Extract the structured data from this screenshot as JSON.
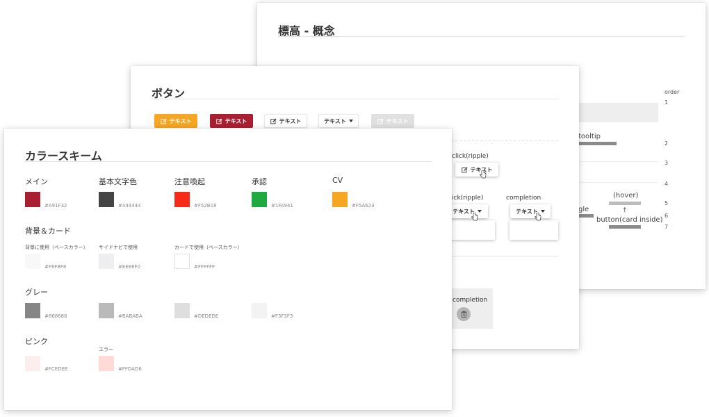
{
  "elevation_card": {
    "title": "標高 - 概念",
    "order_label": "order",
    "order_numbers": [
      "1",
      "2",
      "3",
      "4",
      "5",
      "6",
      "7"
    ],
    "labels": {
      "tooltip": "tooltip",
      "hover": "(hover)",
      "toggle_fragment": "gle",
      "card_inside": "button(card inside)",
      "arrow": "↑"
    }
  },
  "buttons_card": {
    "title": "ボタン",
    "buttons": [
      {
        "label": "テキスト",
        "style": "orange",
        "icon": "edit-icon"
      },
      {
        "label": "テキスト",
        "style": "red",
        "icon": "edit-icon"
      },
      {
        "label": "テキスト",
        "style": "outline",
        "icon": "edit-icon"
      },
      {
        "label": "テキスト",
        "style": "outline-dropdown",
        "icon": "chevron-down-icon"
      },
      {
        "label": "テキスト",
        "style": "disabled",
        "icon": "edit-icon"
      }
    ],
    "click_ripple_label": "click(ripple)",
    "click_ripple_button": "テキスト",
    "ick_ripple_label": "ick(ripple)",
    "dropdown_a_label": "テキスト",
    "completion_label": "completion",
    "dropdown_b_label": "テキスト",
    "completion_label_2": "completion"
  },
  "color_card": {
    "title": "カラースキーム",
    "main_colors": [
      {
        "name": "メイン",
        "hex": "#A91F32"
      },
      {
        "name": "基本文字色",
        "hex": "#444444"
      },
      {
        "name": "注意喚起",
        "hex": "#F52B18"
      },
      {
        "name": "承認",
        "hex": "#1FA941"
      },
      {
        "name": "CV",
        "hex": "#F5A623"
      }
    ],
    "bg_section": "背景＆カード",
    "bg_colors": [
      {
        "desc": "背景に使用（ベースカラー）",
        "hex": "#F8F8F8"
      },
      {
        "desc": "サイドナビで使用",
        "hex": "#EEEEF0"
      },
      {
        "desc": "カードで使用（ベースカラー）",
        "hex": "#FFFFFF"
      }
    ],
    "gray_section": "グレー",
    "gray_colors": [
      {
        "hex": "#868686"
      },
      {
        "hex": "#BABABA"
      },
      {
        "hex": "#DEDEDE"
      },
      {
        "hex": "#F3F3F3"
      }
    ],
    "pink_section": "ピンク",
    "error_label": "エラー",
    "pink_colors": [
      {
        "hex": "#FCEDEE"
      },
      {
        "hex": "#FFDAD6"
      }
    ]
  }
}
